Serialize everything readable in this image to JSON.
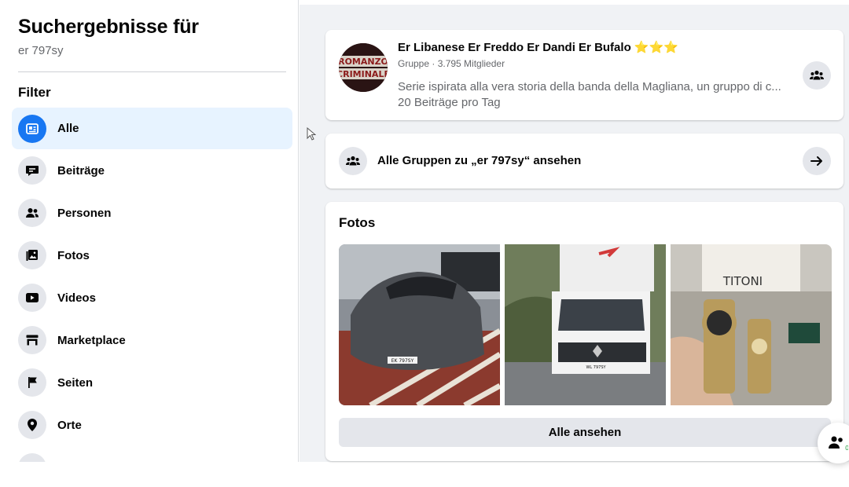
{
  "sidebar": {
    "title": "Suchergebnisse für",
    "query": "er 797sy",
    "filter_label": "Filter",
    "items": [
      {
        "label": "Alle",
        "icon": "feed-icon",
        "active": true
      },
      {
        "label": "Beiträge",
        "icon": "posts-icon"
      },
      {
        "label": "Personen",
        "icon": "people-icon"
      },
      {
        "label": "Fotos",
        "icon": "photos-icon"
      },
      {
        "label": "Videos",
        "icon": "video-icon"
      },
      {
        "label": "Marketplace",
        "icon": "marketplace-icon"
      },
      {
        "label": "Seiten",
        "icon": "flag-icon"
      },
      {
        "label": "Orte",
        "icon": "location-pin-icon"
      }
    ]
  },
  "group_card": {
    "name": "Er Libanese Er Freddo Er Dandi Er Bufalo ⭐⭐⭐",
    "meta": "Gruppe · 3.795 Mitglieder",
    "description": "Serie ispirata alla vera storia della banda della Magliana, un gruppo di c...",
    "rate": "20 Beiträge pro Tag",
    "avatar_text": "ROMANZO CRIMINALE"
  },
  "all_groups": {
    "label": "Alle Gruppen zu „er 797sy“ ansehen"
  },
  "photos": {
    "title": "Fotos",
    "see_all": "Alle ansehen",
    "items": [
      {
        "description": "grey sports car",
        "plate": "EK 797SY"
      },
      {
        "description": "white van",
        "plate": "WL 797SY"
      },
      {
        "description": "wristwatches",
        "brand": "TITONI"
      }
    ]
  },
  "chat_badge": "0",
  "colors": {
    "accent": "#1877f2",
    "active_bg": "#e7f3ff",
    "main_bg": "#f0f2f5",
    "icon_bg": "#e4e6eb",
    "secondary_text": "#65676b"
  }
}
